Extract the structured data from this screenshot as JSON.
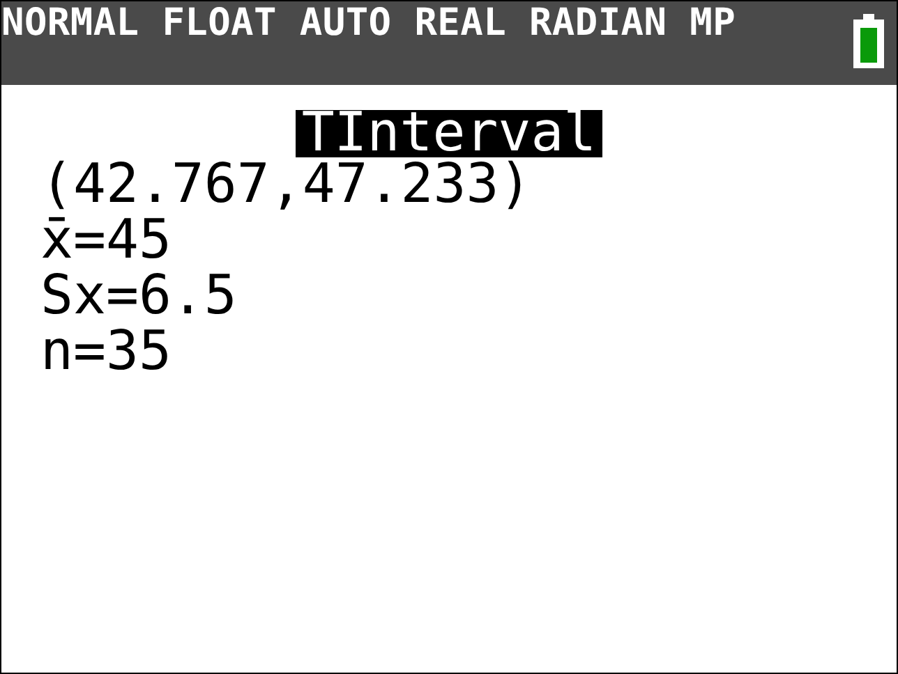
{
  "status_bar": {
    "text": "NORMAL FLOAT AUTO REAL RADIAN MP"
  },
  "title": "TInterval",
  "lines": [
    "(42.767,47.233)",
    "x̄=45",
    "Sx=6.5",
    "n=35"
  ]
}
